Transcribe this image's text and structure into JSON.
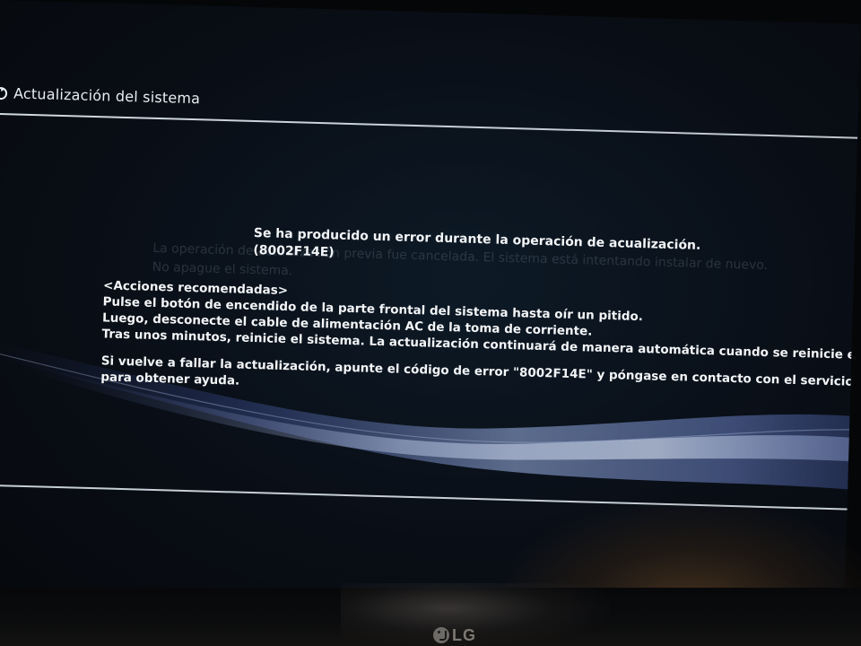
{
  "header": {
    "icon": "update-icon",
    "title": "Actualización del sistema"
  },
  "ghost_text": {
    "line1": "La operación de actualización previa fue cancelada. El sistema está intentando instalar de nuevo.",
    "line2": "No apague el sistema."
  },
  "error": {
    "message": "Se ha producido un error durante la operación de acualización.",
    "code": "(8002F14E)"
  },
  "recommended_actions": {
    "heading": "<Acciones recomendadas>",
    "step1": "Pulse el botón de encendido de la parte frontal del sistema hasta oír un pitido.",
    "step2": "Luego, desconecte el cable de alimentación AC de la toma de corriente.",
    "step3": "Tras unos minutos, reinicie el sistema. La actualización continuará de manera automática cuando se reinicie el sistema.",
    "support_line1": "Si vuelve a fallar la actualización, apunte el código de error \"8002F14E\" y póngase en contacto con el servicio técnico",
    "support_line2": "para obtener ayuda."
  },
  "tv": {
    "brand": "LG"
  },
  "colors": {
    "background": "#0a1019",
    "text": "#f3f5f7",
    "rule": "#dce4ec"
  }
}
